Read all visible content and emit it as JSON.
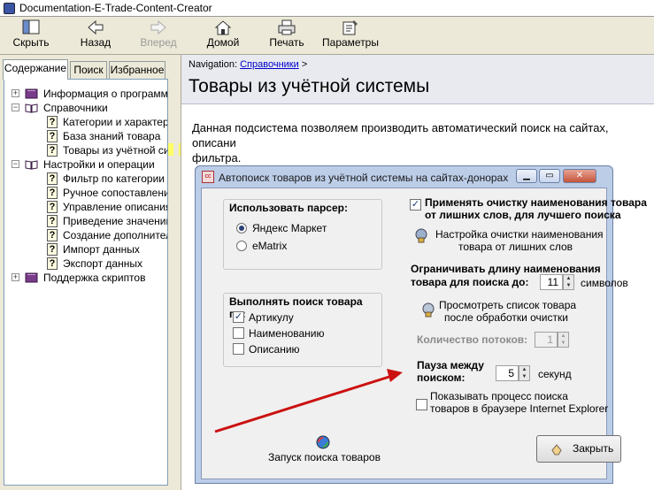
{
  "window": {
    "title": "Documentation-E-Trade-Content-Creator"
  },
  "toolbar": {
    "hide": "Скрыть",
    "back": "Назад",
    "forward": "Вперед",
    "home": "Домой",
    "print": "Печать",
    "options": "Параметры"
  },
  "tabs": {
    "contents": "Содержание",
    "search": "Поиск",
    "favorites": "Избранное"
  },
  "tree": {
    "items": [
      "Информация о программе",
      "Справочники",
      "Категории и характеристики",
      "База знаний товара",
      "Товары из учётной системы",
      "Настройки и операции",
      "Фильтр по категории товаров",
      "Ручное сопоставление",
      "Управление описаниями",
      "Приведение значений",
      "Создание дополнительных",
      "Импорт данных",
      "Экспорт данных",
      "Поддержка скриптов"
    ]
  },
  "content": {
    "nav_label": "Navigation:",
    "nav_link": "Справочники",
    "nav_sep": ">",
    "title": "Товары из учётной системы",
    "desc_line1": "Данная подсистема позволяем производить автоматический поиск на сайтах, описани",
    "desc_line2": "фильтра."
  },
  "dialog": {
    "title": "Автопоиск товаров из учётной системы на сайтах-донорах",
    "icon_text": "cc",
    "parser_group": "Использовать парсер:",
    "parser_yandex": "Яндекс Маркет",
    "parser_ematrix": "eMatrix",
    "search_group": "Выполнять поиск товара по:",
    "search_article": "Артикулу",
    "search_name": "Наименованию",
    "search_desc": "Описанию",
    "apply_clean_1": "Применять очистку наименования товара",
    "apply_clean_2": "от лишних слов, для лучшего поиска",
    "clean_setup_1": "Настройка очистки наименования",
    "clean_setup_2": "товара от лишних слов",
    "limit_1": "Ограничивать длину наименования",
    "limit_2": "товара для поиска до:",
    "limit_value": "11",
    "limit_unit": "символов",
    "view_list_1": "Просмотреть список товара",
    "view_list_2": "после обработки очистки",
    "threads_label": "Количество потоков:",
    "threads_value": "1",
    "pause_1": "Пауза между",
    "pause_2": "поиском:",
    "pause_value": "5",
    "pause_unit": "секунд",
    "show_proc_1": "Показывать процесс поиска",
    "show_proc_2": "товаров в браузере Internet Explorer",
    "start_search": "Запуск поиска товаров",
    "close": "Закрыть"
  },
  "colors": {
    "highlight": "#ffff66",
    "arrow": "#cc1111",
    "link": "#0000cc"
  }
}
